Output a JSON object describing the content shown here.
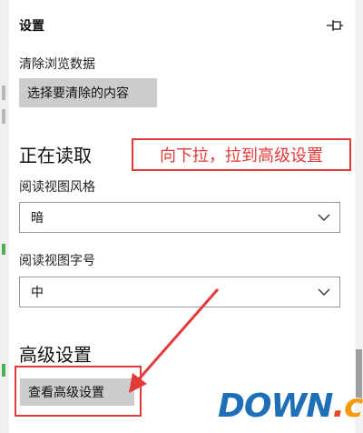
{
  "panel": {
    "title": "设置",
    "pin_icon": "pin-icon"
  },
  "clear_data": {
    "label": "清除浏览数据",
    "button": "选择要清除的内容"
  },
  "reading": {
    "section_title": "正在读取",
    "style_label": "阅读视图风格",
    "style_value": "暗",
    "fontsize_label": "阅读视图字号",
    "fontsize_value": "中"
  },
  "advanced": {
    "section_title": "高级设置",
    "button": "查看高级设置"
  },
  "annotation": {
    "callout_text": "向下拉，拉到高级设置",
    "color": "#e33b3b"
  },
  "watermark": {
    "prefix": "DOWN",
    "dot": ".",
    "suffix": "cc"
  },
  "colors": {
    "button_bg": "#cccccc",
    "select_border": "#9a9a9a",
    "accent": "#1d6fb8"
  }
}
